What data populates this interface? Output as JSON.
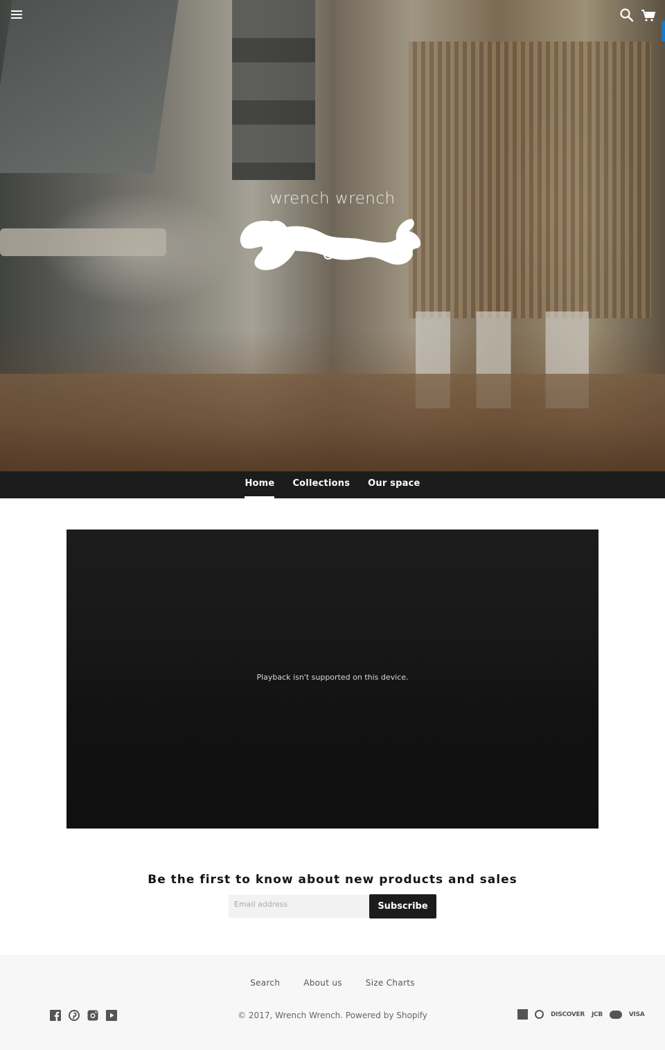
{
  "header": {
    "menu_icon": "hamburger-menu-icon",
    "search_icon": "search-icon",
    "cart_icon": "cart-icon"
  },
  "hero": {
    "logo_text": "wrench wrench",
    "logo_mark": "wrench-logo-mark"
  },
  "nav": {
    "items": [
      {
        "label": "Home",
        "active": true
      },
      {
        "label": "Collections",
        "active": false
      },
      {
        "label": "Our space",
        "active": false
      }
    ]
  },
  "video": {
    "message": "Playback isn't supported on this device."
  },
  "newsletter": {
    "title": "Be the first to know about new products and sales",
    "email_placeholder": "Email address",
    "email_value": "",
    "subscribe_label": "Subscribe"
  },
  "footer": {
    "links": [
      "Search",
      "About us",
      "Size Charts"
    ],
    "social_icons": [
      "facebook-icon",
      "pinterest-icon",
      "instagram-icon",
      "youtube-icon"
    ],
    "copyright_prefix": "© 2017, ",
    "store_name": "Wrench Wrench",
    "powered_by": ". Powered by Shopify",
    "payment_methods": [
      "American Express",
      "Diners Club",
      "DISCOVER",
      "JCB",
      "Master",
      "VISA"
    ]
  },
  "colors": {
    "nav_bg": "#1c1c1c",
    "footer_bg": "#f7f7f7",
    "button_bg": "#1c1c1c",
    "text_dark": "#141414"
  }
}
